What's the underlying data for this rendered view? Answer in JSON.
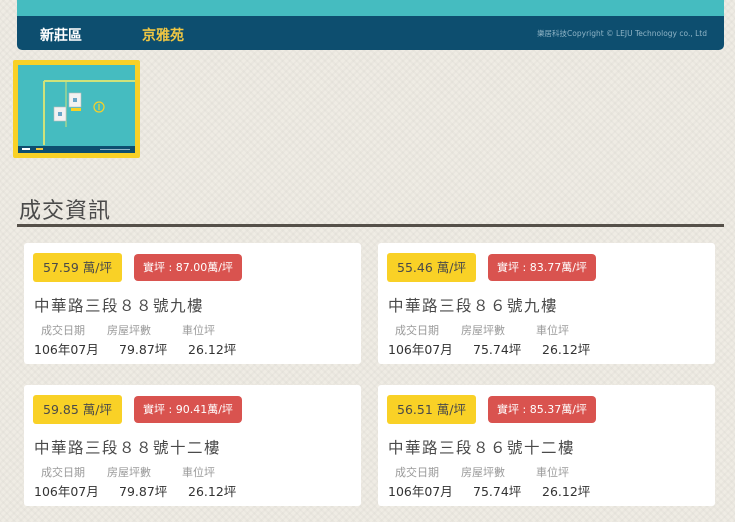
{
  "header": {
    "district": "新莊區",
    "community": "京雅苑",
    "copyright": "樂居科技Copyright © LEJU Technology co., Ltd"
  },
  "section": {
    "title": "成交資訊"
  },
  "transactions": [
    {
      "price": "57.59 萬/坪",
      "real_price": "實坪 : 87.00萬/坪",
      "address": "中華路三段８８號九樓",
      "date_label": "成交日期",
      "area_label": "房屋坪數",
      "parking_label": "車位坪",
      "date": "106年07月",
      "area": "79.87坪",
      "parking": "26.12坪"
    },
    {
      "price": "55.46 萬/坪",
      "real_price": "實坪 : 83.77萬/坪",
      "address": "中華路三段８６號九樓",
      "date_label": "成交日期",
      "area_label": "房屋坪數",
      "parking_label": "車位坪",
      "date": "106年07月",
      "area": "75.74坪",
      "parking": "26.12坪"
    },
    {
      "price": "59.85 萬/坪",
      "real_price": "實坪 : 90.41萬/坪",
      "address": "中華路三段８８號十二樓",
      "date_label": "成交日期",
      "area_label": "房屋坪數",
      "parking_label": "車位坪",
      "date": "106年07月",
      "area": "79.87坪",
      "parking": "26.12坪"
    },
    {
      "price": "56.51 萬/坪",
      "real_price": "實坪 : 85.37萬/坪",
      "address": "中華路三段８６號十二樓",
      "date_label": "成交日期",
      "area_label": "房屋坪數",
      "parking_label": "車位坪",
      "date": "106年07月",
      "area": "75.74坪",
      "parking": "26.12坪"
    }
  ],
  "colors": {
    "teal": "#45bcc0",
    "navy": "#0d4e6f",
    "yellow": "#f9d126",
    "red": "#d9534f"
  },
  "icons": [
    "map-thumbnail"
  ]
}
